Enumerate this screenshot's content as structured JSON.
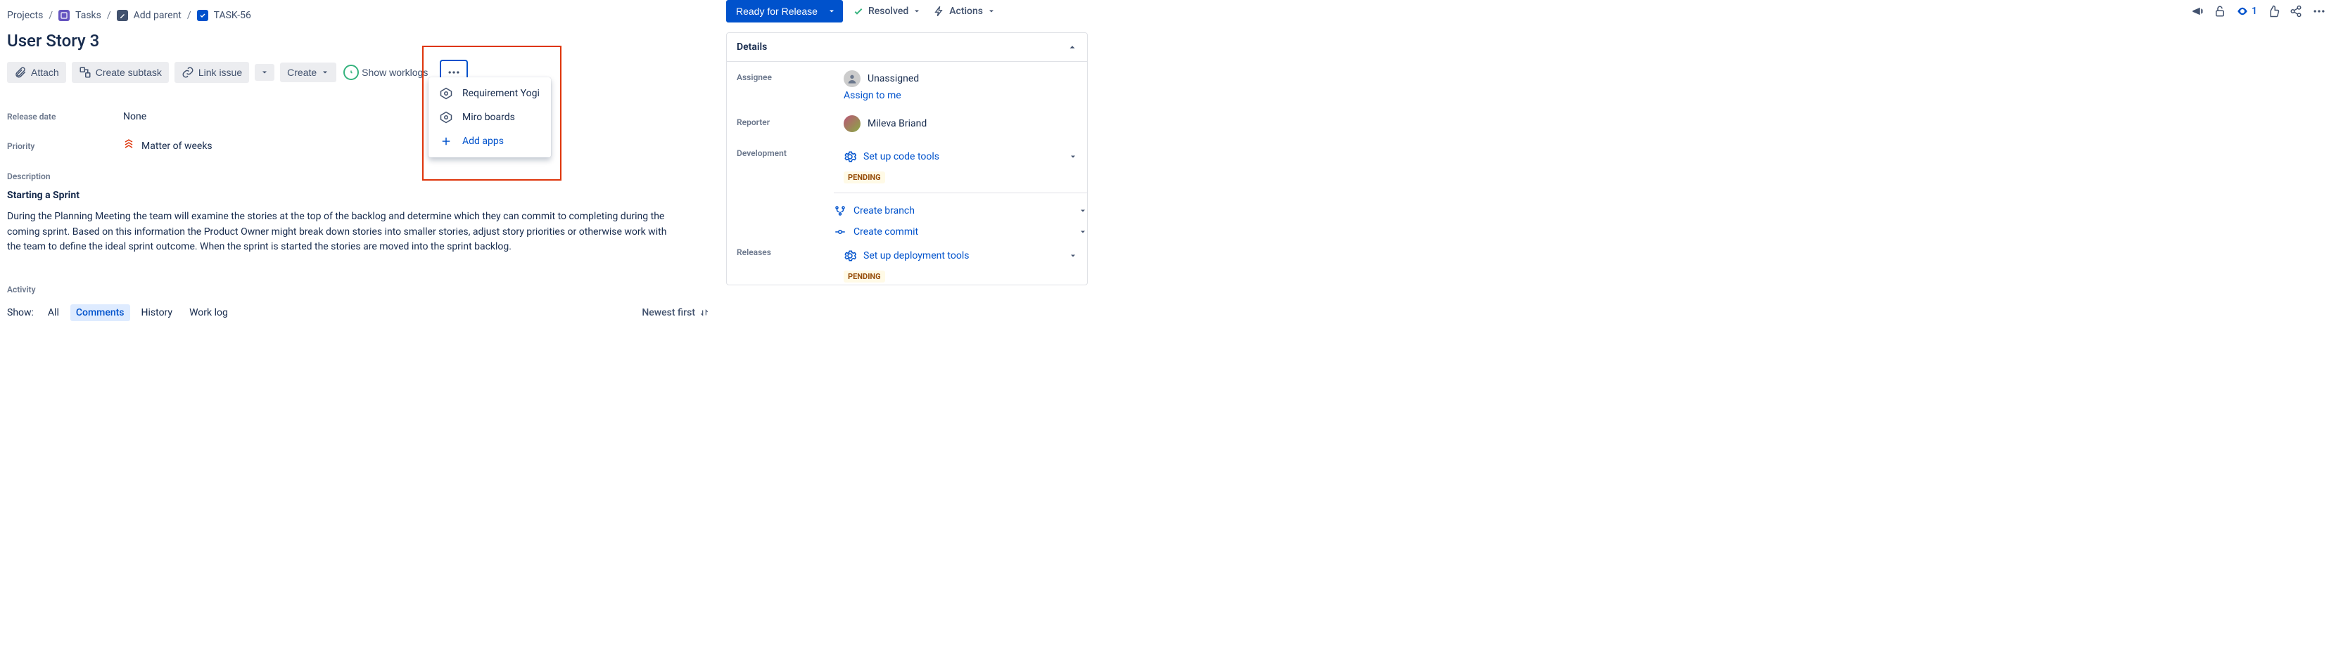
{
  "breadcrumbs": {
    "projects": "Projects",
    "tasks": "Tasks",
    "addParent": "Add parent",
    "key": "TASK-56"
  },
  "toolbarTop": {
    "watchCount": "1"
  },
  "title": "User Story 3",
  "actions": {
    "attach": "Attach",
    "createSubtask": "Create subtask",
    "linkIssue": "Link issue",
    "create": "Create",
    "showWorklogs": "Show worklogs"
  },
  "moreMenu": {
    "item1": "Requirement Yogi",
    "item2": "Miro boards",
    "addApps": "Add apps"
  },
  "fields": {
    "releaseDate": {
      "label": "Release date",
      "value": "None"
    },
    "priority": {
      "label": "Priority",
      "value": "Matter of weeks"
    }
  },
  "description": {
    "label": "Description",
    "heading": "Starting a Sprint",
    "body": "During the Planning Meeting the team will examine the stories at the top of the backlog and determine which they can commit to completing during the coming sprint. Based on this information the Product Owner might break down stories into smaller stories, adjust story priorities or otherwise work with the team to define the ideal sprint outcome. When the sprint is started the stories are moved into the sprint backlog."
  },
  "activity": {
    "label": "Activity",
    "show": "Show:",
    "tabs": {
      "all": "All",
      "comments": "Comments",
      "history": "History",
      "worklog": "Work log"
    },
    "sort": "Newest first"
  },
  "status": {
    "ready": "Ready for Release",
    "resolved": "Resolved",
    "actions": "Actions"
  },
  "details": {
    "head": "Details",
    "assignee": {
      "label": "Assignee",
      "value": "Unassigned",
      "assignToMe": "Assign to me"
    },
    "reporter": {
      "label": "Reporter",
      "value": "Mileva Briand"
    },
    "development": {
      "label": "Development",
      "setupCode": "Set up code tools",
      "pending": "PENDING",
      "createBranch": "Create branch",
      "createCommit": "Create commit"
    },
    "releases": {
      "label": "Releases",
      "setupDeploy": "Set up deployment tools",
      "pending": "PENDING"
    }
  }
}
